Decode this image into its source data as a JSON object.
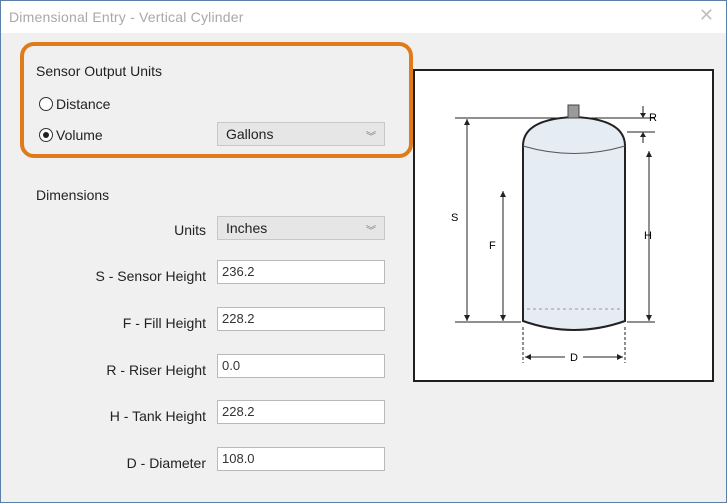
{
  "window": {
    "title": "Dimensional Entry - Vertical Cylinder"
  },
  "sensor_output": {
    "group_label": "Sensor Output Units",
    "options": [
      {
        "label": "Distance",
        "checked": false
      },
      {
        "label": "Volume",
        "checked": true
      }
    ],
    "volume_units": "Gallons"
  },
  "dimensions": {
    "group_label": "Dimensions",
    "units_label": "Units",
    "units_value": "Inches",
    "fields": [
      {
        "label": "S - Sensor Height",
        "value": "236.2"
      },
      {
        "label": "F - Fill Height",
        "value": "228.2"
      },
      {
        "label": "R - Riser Height",
        "value": "0.0"
      },
      {
        "label": "H - Tank Height",
        "value": "228.2"
      },
      {
        "label": "D - Diameter",
        "value": "108.0"
      }
    ]
  },
  "diagram": {
    "labels": {
      "r": "R",
      "s": "S",
      "f": "F",
      "h": "H",
      "d": "D"
    }
  },
  "colors": {
    "highlight": "#e07b1a",
    "tank_fill": "#e6ecf4",
    "tank_stroke": "#222222"
  }
}
